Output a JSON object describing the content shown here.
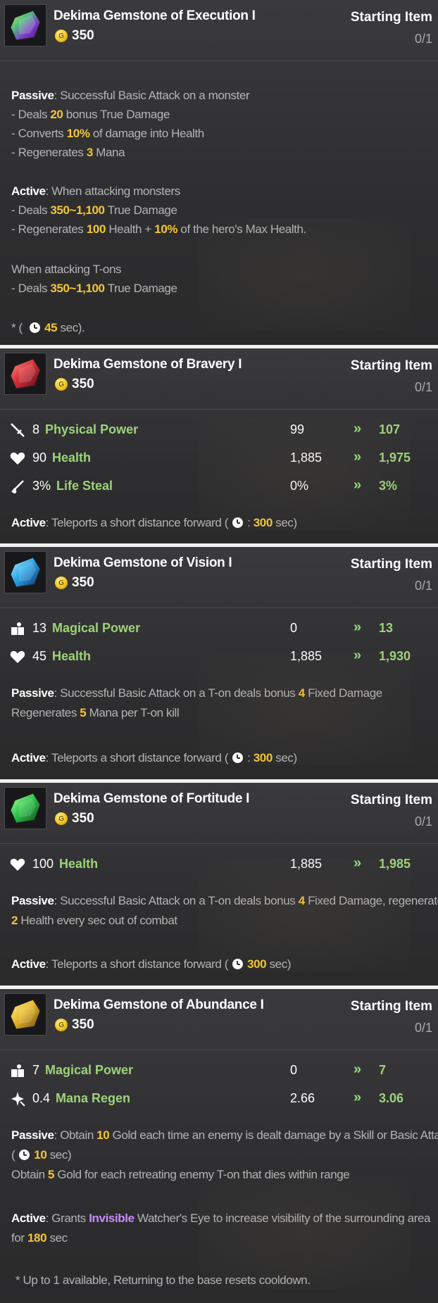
{
  "cards": [
    {
      "name": "Dekima Gemstone of Execution I",
      "price": "350",
      "tag": "Starting Item",
      "count": "0/1",
      "gem_color": "#7c3cc8",
      "passive_label": "Passive",
      "passive_text": ": Successful Basic Attack on a monster",
      "passive_lines": [
        {
          "pre": "- Deals ",
          "val": "20",
          "post": " bonus True Damage"
        },
        {
          "pre": "- Converts ",
          "val": "10%",
          "post": " of damage into Health"
        },
        {
          "pre": "- Regenerates ",
          "val": "3",
          "post": " Mana"
        }
      ],
      "active_label": "Active",
      "active_text": ": When attacking monsters",
      "active_lines": [
        {
          "pre": "- Deals ",
          "val": "350~1,100",
          "post": " True Damage"
        },
        {
          "pre": "- Regenerates ",
          "val": "100",
          "mid": " Health + ",
          "val2": "10%",
          "post": " of the hero's Max Health."
        }
      ],
      "tons_heading": "When attacking T-ons",
      "tons_line": {
        "pre": "- Deals ",
        "val": "350~1,100",
        "post": " True Damage"
      },
      "cooldown": {
        "pre": "* ( ",
        "val": "45",
        "post": " sec)."
      }
    },
    {
      "name": "Dekima Gemstone of Bravery I",
      "price": "350",
      "tag": "Starting Item",
      "count": "0/1",
      "gem_color": "#d8323a",
      "stats": [
        {
          "icon": "sword-icon",
          "amount": "8",
          "name": "Physical Power",
          "old": "99",
          "arrow": "»",
          "new": "107"
        },
        {
          "icon": "heart-icon",
          "amount": "90",
          "name": "Health",
          "old": "1,885",
          "arrow": "»",
          "new": "1,975"
        },
        {
          "icon": "life-steal-icon",
          "amount": "3%",
          "name": "Life Steal",
          "old": "0%",
          "arrow": "»",
          "new": "3%"
        }
      ],
      "active_label": "Active",
      "active_text": ": Teleports a short distance forward (",
      "active_cd_sep": ":",
      "active_cd": "300",
      "active_cd_post": " sec)"
    },
    {
      "name": "Dekima Gemstone of Vision I",
      "price": "350",
      "tag": "Starting Item",
      "count": "0/1",
      "gem_color": "#2fa8e8",
      "stats": [
        {
          "icon": "book-icon",
          "amount": "13",
          "name": "Magical Power",
          "old": "0",
          "arrow": "»",
          "new": "13"
        },
        {
          "icon": "heart-icon",
          "amount": "45",
          "name": "Health",
          "old": "1,885",
          "arrow": "»",
          "new": "1,930"
        }
      ],
      "passive_label": "Passive",
      "passive_pre": ": Successful Basic Attack on a T-on deals bonus ",
      "passive_val": "4",
      "passive_post": " Fixed Damage",
      "passive2_pre": "Regenerates ",
      "passive2_val": "5",
      "passive2_post": " Mana per T-on kill",
      "active_label": "Active",
      "active_text": ": Teleports a short distance forward (",
      "active_cd_sep": ":",
      "active_cd": "300",
      "active_cd_post": " sec)"
    },
    {
      "name": "Dekima Gemstone of Fortitude I",
      "price": "350",
      "tag": "Starting Item",
      "count": "0/1",
      "gem_color": "#2fc84a",
      "stats": [
        {
          "icon": "heart-icon",
          "amount": "100",
          "name": "Health",
          "old": "1,885",
          "arrow": "»",
          "new": "1,985"
        }
      ],
      "passive_label": "Passive",
      "passive_pre": ": Successful Basic Attack on a T-on deals bonus ",
      "passive_val": "4",
      "passive_post": " Fixed Damage, regenerates",
      "passive2_val": "2",
      "passive2_post": " Health every sec out of combat",
      "active_label": "Active",
      "active_text": ": Teleports a short distance forward (",
      "active_cd": "300",
      "active_cd_post": " sec)"
    },
    {
      "name": "Dekima Gemstone of Abundance I",
      "price": "350",
      "tag": "Starting Item",
      "count": "0/1",
      "gem_color": "#e8b82a",
      "stats": [
        {
          "icon": "book-icon",
          "amount": "7",
          "name": "Magical Power",
          "old": "0",
          "arrow": "»",
          "new": "7"
        },
        {
          "icon": "mana-regen-icon",
          "amount": "0.4",
          "name": "Mana Regen",
          "old": "2.66",
          "arrow": "»",
          "new": "3.06"
        }
      ],
      "passive_label": "Passive",
      "passive_pre": ": Obtain ",
      "passive_val": "10",
      "passive_post": " Gold each time an enemy is dealt damage by a Skill or Basic Attack",
      "passive_cd_pre": "(",
      "passive_cd": "10",
      "passive_cd_post": " sec)",
      "passive3_pre": "Obtain ",
      "passive3_val": "5",
      "passive3_post": " Gold for each retreating enemy T-on that dies within range",
      "active_label": "Active",
      "active_pre": ": Grants ",
      "active_inv": "Invisible",
      "active_post": " Watcher's Eye to increase visibility of the surrounding area",
      "active2_pre": "for ",
      "active2_val": "180",
      "active2_post": " sec",
      "footnote": "* Up to 1 available, Returning to the base resets cooldown."
    }
  ]
}
